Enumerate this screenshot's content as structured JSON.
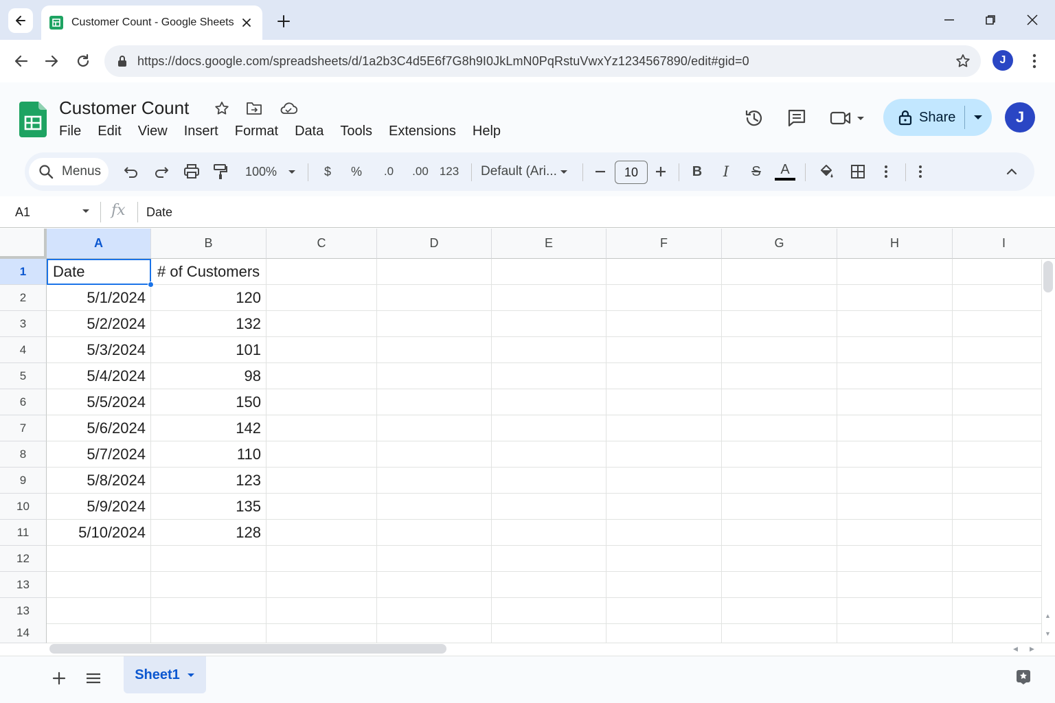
{
  "browser": {
    "tab_title": "Customer Count - Google Sheets",
    "url": "https://docs.google.com/spreadsheets/d/1a2b3C4d5E6f7G8h9I0JkLmN0PqRstuVwxYz1234567890/edit#gid=0",
    "profile_initial": "J"
  },
  "doc": {
    "title": "Customer Count",
    "menus": [
      "File",
      "Edit",
      "View",
      "Insert",
      "Format",
      "Data",
      "Tools",
      "Extensions",
      "Help"
    ],
    "share_label": "Share",
    "profile_initial": "J"
  },
  "toolbar": {
    "search_label": "Menus",
    "zoom": "100%",
    "currency": "$",
    "percent": "%",
    "decrease_decimal": ".0",
    "increase_decimal": ".00",
    "number_format": "123",
    "font": "Default (Ari...",
    "font_size": "10",
    "bold": "B",
    "italic": "I",
    "strike": "S",
    "text_color_glyph": "A"
  },
  "formula_bar": {
    "cell_ref": "A1",
    "fx": "fx",
    "content": "Date"
  },
  "sheet": {
    "columns": [
      "A",
      "B",
      "C",
      "D",
      "E",
      "F",
      "G",
      "H",
      "I"
    ],
    "row_labels": [
      "1",
      "2",
      "3",
      "4",
      "5",
      "6",
      "7",
      "8",
      "9",
      "10",
      "11",
      "12",
      "13",
      "13",
      "14"
    ],
    "headers": [
      "Date",
      "# of Customers"
    ],
    "rows": [
      [
        "5/1/2024",
        "120"
      ],
      [
        "5/2/2024",
        "132"
      ],
      [
        "5/3/2024",
        "101"
      ],
      [
        "5/4/2024",
        "98"
      ],
      [
        "5/5/2024",
        "150"
      ],
      [
        "5/6/2024",
        "142"
      ],
      [
        "5/7/2024",
        "110"
      ],
      [
        "5/8/2024",
        "123"
      ],
      [
        "5/9/2024",
        "135"
      ],
      [
        "5/10/2024",
        "128"
      ]
    ],
    "active_cell": "A1"
  },
  "sheet_tabs": {
    "tabs": [
      "Sheet1"
    ]
  },
  "colors": {
    "accent": "#0b57d0",
    "selection": "#1a73e8",
    "share_bg": "#c2e7ff",
    "sheets_green": "#1ea362"
  }
}
